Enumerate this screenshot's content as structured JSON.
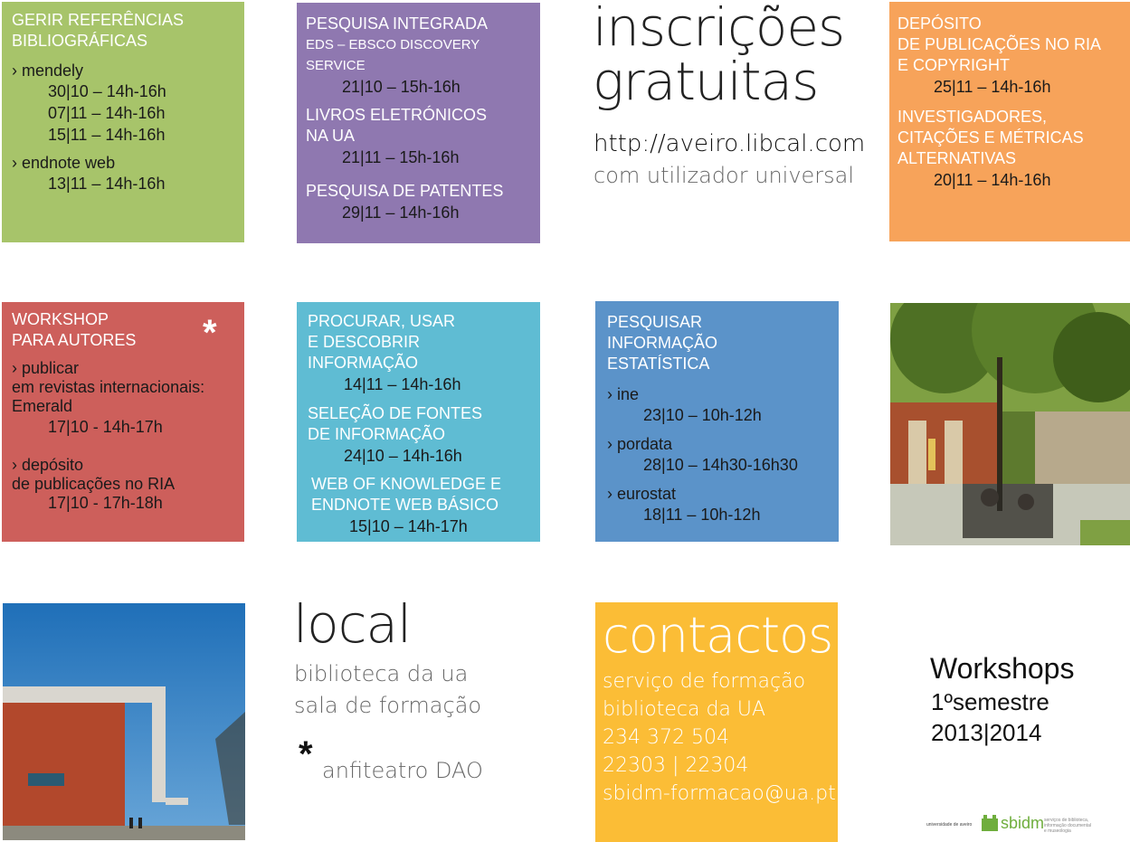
{
  "tiles": {
    "referencias": {
      "title": [
        "GERIR REFERÊNCIAS",
        "BIBLIOGRÁFICAS"
      ],
      "mendeley": {
        "label": "› mendely",
        "dates": [
          "30|10 – 14h-16h",
          "07|11 – 14h-16h",
          "15|11 – 14h-16h"
        ]
      },
      "endnote": {
        "label": "› endnote web",
        "dates": [
          "13|11 – 14h-16h"
        ]
      }
    },
    "pesquisa": {
      "title": "PESQUISA INTEGRADA",
      "subtitle": [
        "EDS – EBSCO DISCOVERY",
        "SERVICE"
      ],
      "date1": "21|10 – 15h-16h",
      "livros": [
        "LIVROS ELETRÓNICOS",
        "NA UA"
      ],
      "date2": "21|11 – 15h-16h",
      "patentes": "PESQUISA DE PATENTES",
      "date3": "29|11 – 14h-16h"
    },
    "deposito": {
      "title": [
        "DEPÓSITO",
        "DE PUBLICAÇÕES NO RIA",
        "E COPYRIGHT"
      ],
      "date1": "25|11 – 14h-16h",
      "investigadores": [
        "INVESTIGADORES,",
        "CITAÇÕES E MÉTRICAS",
        "ALTERNATIVAS"
      ],
      "date2": "20|11 – 14h-16h"
    },
    "workshop": {
      "title": [
        "WORKSHOP",
        "PARA AUTORES"
      ],
      "asterisk": "*",
      "publicar": [
        "› publicar",
        "em revistas internacionais:",
        "Emerald"
      ],
      "date1": "17|10 - 14h-17h",
      "depositoria": [
        "› depósito",
        "de publicações no RIA"
      ],
      "date2": "17|10 - 17h-18h"
    },
    "procurar": {
      "title": [
        "PROCURAR, USAR",
        "E DESCOBRIR",
        "INFORMAÇÃO"
      ],
      "date1": "14|11 – 14h-16h",
      "selecao": [
        "SELEÇÃO DE FONTES",
        "DE INFORMAÇÃO"
      ],
      "date2": "24|10 – 14h-16h",
      "wok": [
        "WEB OF KNOWLEDGE E",
        "ENDNOTE WEB BÁSICO"
      ],
      "date3": "15|10 – 14h-17h"
    },
    "estatistica": {
      "title": [
        "PESQUISAR",
        "INFORMAÇÃO",
        "ESTATÍSTICA"
      ],
      "items": [
        {
          "label": "› ine",
          "date": "23|10 – 10h-12h"
        },
        {
          "label": "› pordata",
          "date": "28|10 – 14h30-16h30"
        },
        {
          "label": "› eurostat",
          "date": "18|11 – 10h-12h"
        }
      ]
    }
  },
  "inscricoes": {
    "heading": [
      "inscrições",
      "gratuitas"
    ],
    "url": "http://aveiro.libcal.com",
    "note": "com utilizador universal"
  },
  "local": {
    "heading": "local",
    "lines": [
      "biblioteca da ua",
      "sala de formação"
    ],
    "asterisk": "*",
    "alt": "anfiteatro DAO"
  },
  "contactos": {
    "heading": "contactos",
    "lines": [
      "serviço de formação",
      "biblioteca da UA",
      "234 372 504",
      "22303 | 22304",
      "sbidm-formacao@ua.pt"
    ]
  },
  "workshops_label": {
    "title": "Workshops",
    "semester": "1ºsemestre",
    "year": "2013|2014"
  },
  "footer": {
    "university": "universidade de aveiro",
    "brand": "sbidm",
    "tagline": [
      "serviços de biblioteca,",
      "informação documental",
      "e museologia"
    ]
  },
  "colors": {
    "green": "#a7c46a",
    "purple": "#8f78b0",
    "orange": "#f7a35a",
    "red": "#cd5f5b",
    "cyan": "#5fbcd3",
    "blue": "#5b93c9",
    "yellow": "#fbbd36",
    "brand_green": "#6fae3d"
  }
}
